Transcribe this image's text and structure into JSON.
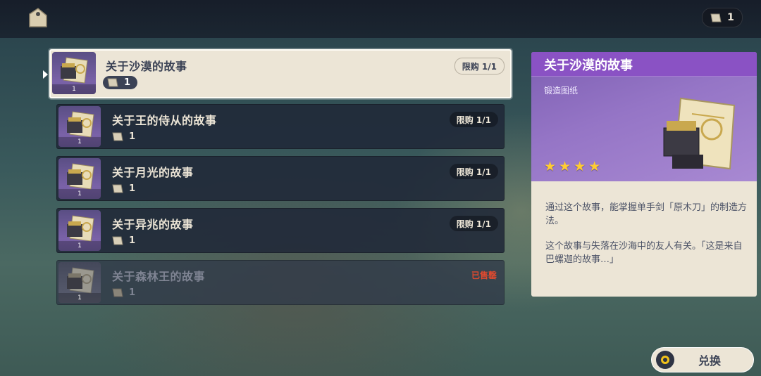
{
  "header": {
    "shop_icon": "tag-icon",
    "currency_icon": "paper-scroll-icon",
    "currency_amount": "1"
  },
  "items": [
    {
      "title": "关于沙漠的故事",
      "cost": "1",
      "qty": "1",
      "limit": "限购 1/1",
      "status": "",
      "selected": true
    },
    {
      "title": "关于王的侍从的故事",
      "cost": "1",
      "qty": "1",
      "limit": "限购 1/1",
      "status": "",
      "selected": false
    },
    {
      "title": "关于月光的故事",
      "cost": "1",
      "qty": "1",
      "limit": "限购 1/1",
      "status": "",
      "selected": false
    },
    {
      "title": "关于异兆的故事",
      "cost": "1",
      "qty": "1",
      "limit": "限购 1/1",
      "status": "",
      "selected": false
    },
    {
      "title": "关于森林王的故事",
      "cost": "1",
      "qty": "1",
      "limit": "",
      "status": "已售罄",
      "selected": false
    }
  ],
  "detail": {
    "title": "关于沙漠的故事",
    "type": "锻造图纸",
    "stars": 4,
    "desc_1": "通过这个故事，能掌握单手剑「原木刀」的制造方法。",
    "desc_2": "这个故事与失落在沙海中的友人有关。「这是来自巴螺迦的故事…」"
  },
  "actions": {
    "exchange_label": "兑换"
  },
  "colors": {
    "rarity_purple": "#8a52c4",
    "star_gold": "#ffcc32",
    "soldout_red": "#e04a2f",
    "panel_cream": "#ece5d6"
  }
}
